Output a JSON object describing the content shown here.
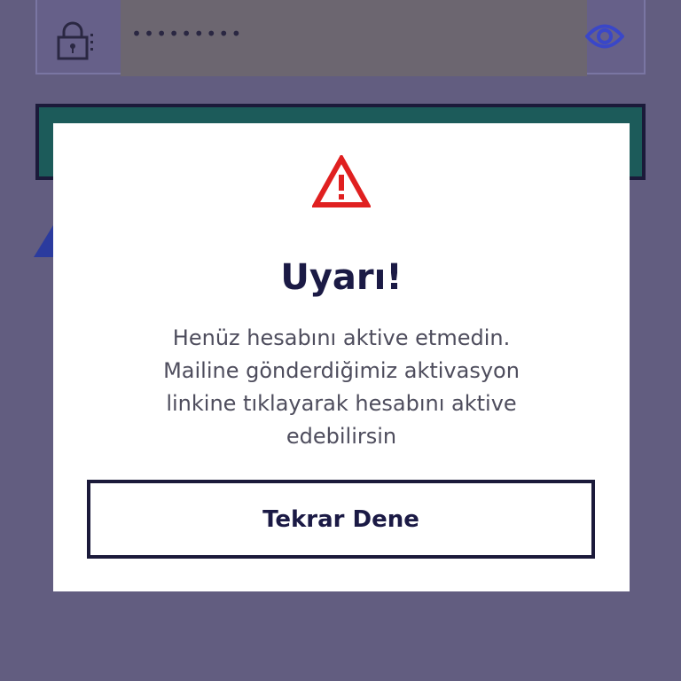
{
  "login_form": {
    "password_value": "•••••••••"
  },
  "modal": {
    "title": "Uyarı!",
    "message_lines": [
      "Henüz hesabını aktive etmedin.",
      "Mailine gönderdiğimiz aktivasyon",
      "linkine tıklayarak hesabını aktive",
      "edebilirsin"
    ],
    "retry_label": "Tekrar Dene"
  },
  "icons": {
    "lock": "lock-icon",
    "eye": "eye-icon",
    "warning": "warning-icon"
  },
  "colors": {
    "overlay_background": "#625d80",
    "modal_background": "#ffffff",
    "title_text": "#1b1a45",
    "message_text": "#4e4d5d",
    "warning_red": "#e02020",
    "submit_green": "#1c5b5a",
    "eye_blue": "#3a47c8"
  }
}
